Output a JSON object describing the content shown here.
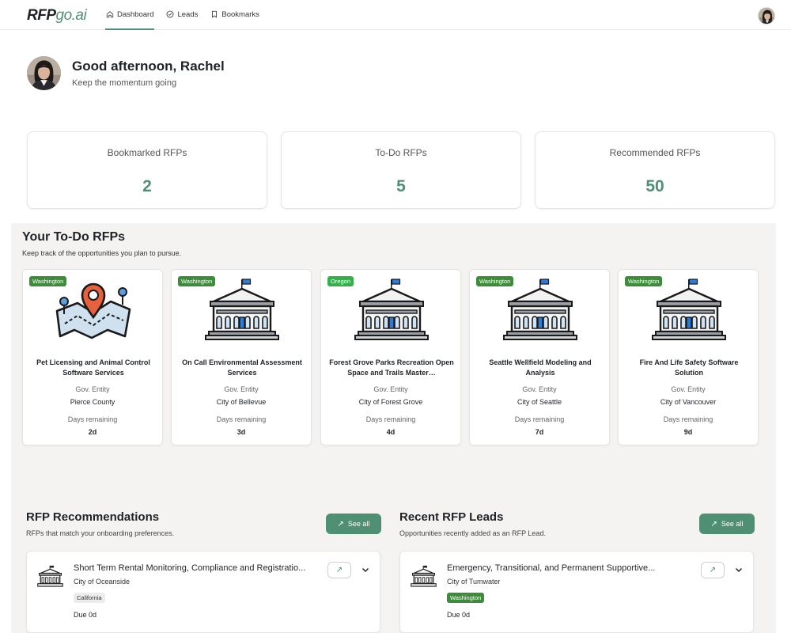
{
  "nav": {
    "logo_main": "RFP",
    "logo_accent": "go.ai",
    "links": [
      {
        "label": "Dashboard",
        "icon": "home-icon",
        "active": true
      },
      {
        "label": "Leads",
        "icon": "check-circle-icon",
        "active": false
      },
      {
        "label": "Bookmarks",
        "icon": "bookmark-icon",
        "active": false
      }
    ]
  },
  "greeting": {
    "title": "Good afternoon, Rachel",
    "subtitle": "Keep the momentum going"
  },
  "stats": [
    {
      "label": "Bookmarked RFPs",
      "value": "2"
    },
    {
      "label": "To-Do RFPs",
      "value": "5"
    },
    {
      "label": "Recommended RFPs",
      "value": "50"
    }
  ],
  "todo": {
    "title": "Your To-Do RFPs",
    "subtitle": "Keep track of the opportunities you plan to pursue.",
    "entity_label": "Gov. Entity",
    "days_label": "Days remaining",
    "cards": [
      {
        "state": "Washington",
        "icon": "map-pin-icon",
        "title": "Pet Licensing and Animal Control Software Services",
        "entity": "Pierce County",
        "days": "2d"
      },
      {
        "state": "Washington",
        "icon": "government-building-icon",
        "title": "On Call Environmental Assessment Services",
        "entity": "City of Bellevue",
        "days": "3d"
      },
      {
        "state": "Oregon",
        "icon": "government-building-icon",
        "title": "Forest Grove Parks Recreation Open Space and Trails Master…",
        "entity": "City of Forest Grove",
        "days": "4d"
      },
      {
        "state": "Washington",
        "icon": "government-building-icon",
        "title": "Seattle Wellfield Modeling and Analysis",
        "entity": "City of Seattle",
        "days": "7d"
      },
      {
        "state": "Washington",
        "icon": "government-building-icon",
        "title": "Fire And Life Safety Software Solution",
        "entity": "City of Vancouver",
        "days": "9d"
      }
    ]
  },
  "recommendations": {
    "title": "RFP Recommendations",
    "subtitle": "RFPs that match your onboarding preferences.",
    "see_all": "See all",
    "item": {
      "name": "Short Term Rental Monitoring, Compliance and Registratio...",
      "city": "City of Oceanside",
      "state": "California",
      "due": "Due 0d"
    }
  },
  "leads": {
    "title": "Recent RFP Leads",
    "subtitle": "Opportunities recently added as an RFP Lead.",
    "see_all": "See all",
    "item": {
      "name": "Emergency, Transitional, and Permanent Supportive...",
      "city": "City of Tumwater",
      "state": "Washington",
      "due": "Due 0d"
    }
  },
  "colors": {
    "accent": "#4f8f74",
    "badge_washington": "#3c8c3a",
    "badge_oregon": "#34b04b",
    "section_bg": "#f5f3f1"
  }
}
